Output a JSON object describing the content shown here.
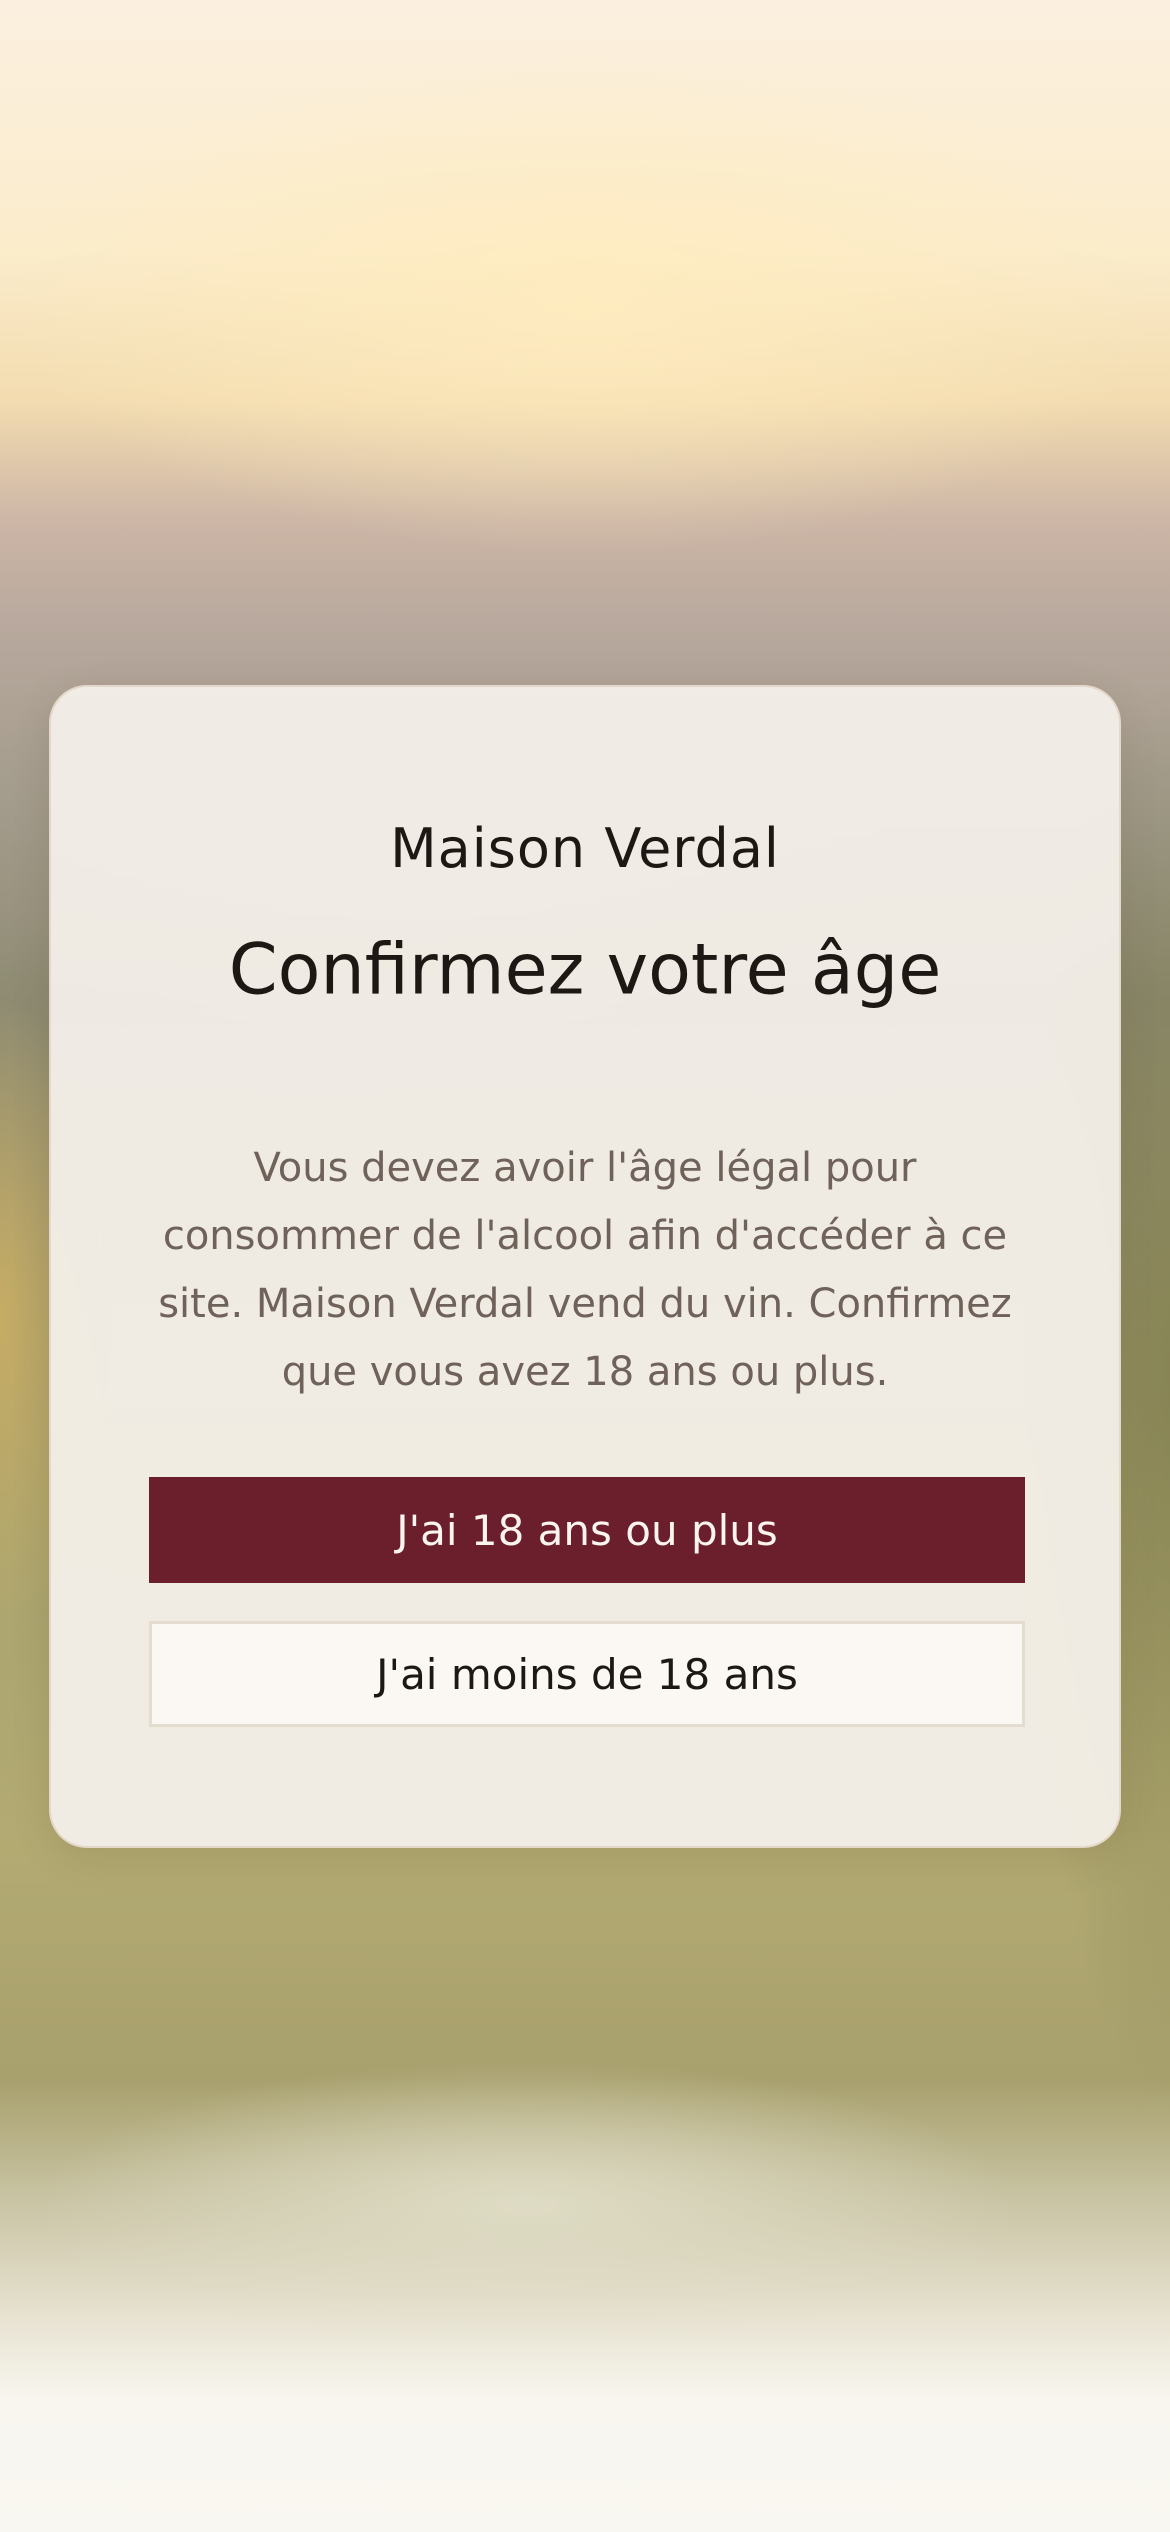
{
  "dialog": {
    "brand": "Maison Verdal",
    "title": "Confirmez votre âge",
    "description": "Vous devez avoir l'âge légal pour consommer de l'alcool afin d'accéder à ce site. Maison Verdal vend du vin. Confirmez que vous avez 18 ans ou plus.",
    "confirm_label": "J'ai 18 ans ou plus",
    "decline_label": "J'ai moins de 18 ans"
  },
  "colors": {
    "primary_button": "#6b1e2c",
    "secondary_button": "#fbf8f3",
    "text_dark": "#1d1814",
    "text_muted": "#6f625a"
  }
}
